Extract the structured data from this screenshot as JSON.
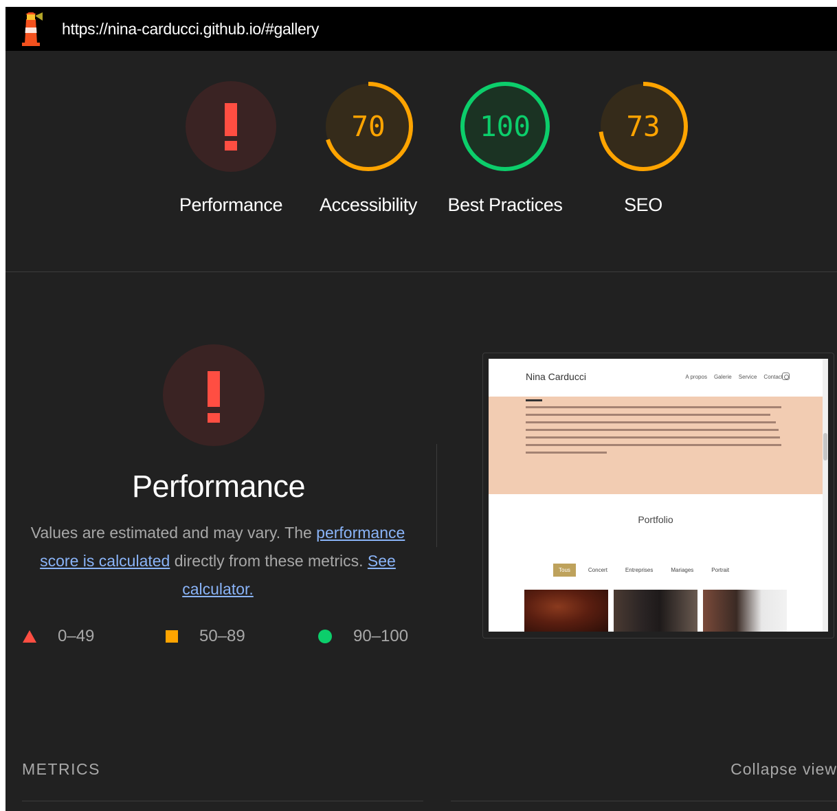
{
  "url_bar": {
    "url": "https://nina-carducci.github.io/#gallery"
  },
  "scores": [
    {
      "id": "performance",
      "label": "Performance",
      "value": null,
      "display": "!",
      "status": "error",
      "color": "#ff4e42"
    },
    {
      "id": "accessibility",
      "label": "Accessibility",
      "value": 70,
      "display": "70",
      "status": "average",
      "color": "#ffa400"
    },
    {
      "id": "best-practices",
      "label": "Best Practices",
      "value": 100,
      "display": "100",
      "status": "pass",
      "color": "#0cce6b"
    },
    {
      "id": "seo",
      "label": "SEO",
      "value": 73,
      "display": "73",
      "status": "average",
      "color": "#ffa400"
    }
  ],
  "performance_section": {
    "icon": "!",
    "title": "Performance",
    "desc_prefix": "Values are estimated and may vary. The ",
    "desc_link_1": "performance score is calculated",
    "desc_middle": " directly from these metrics. ",
    "desc_link_2": "See calculator."
  },
  "legend": [
    {
      "shape": "triangle",
      "range": "0–49",
      "color": "#ff4e42"
    },
    {
      "shape": "square",
      "range": "50–89",
      "color": "#ffa400"
    },
    {
      "shape": "circle",
      "range": "90–100",
      "color": "#0cce6b"
    }
  ],
  "screenshot": {
    "site_name": "Nina Carducci",
    "nav": [
      "A propos",
      "Galerie",
      "Service",
      "Contact"
    ],
    "portfolio_title": "Portfolio",
    "filters": [
      "Tous",
      "Concert",
      "Entreprises",
      "Mariages",
      "Portrait"
    ],
    "active_filter": "Tous",
    "about_band_color": "#f2ccb2",
    "active_filter_color": "#bea25c"
  },
  "metrics": {
    "label": "METRICS",
    "collapse_label": "Collapse view"
  }
}
